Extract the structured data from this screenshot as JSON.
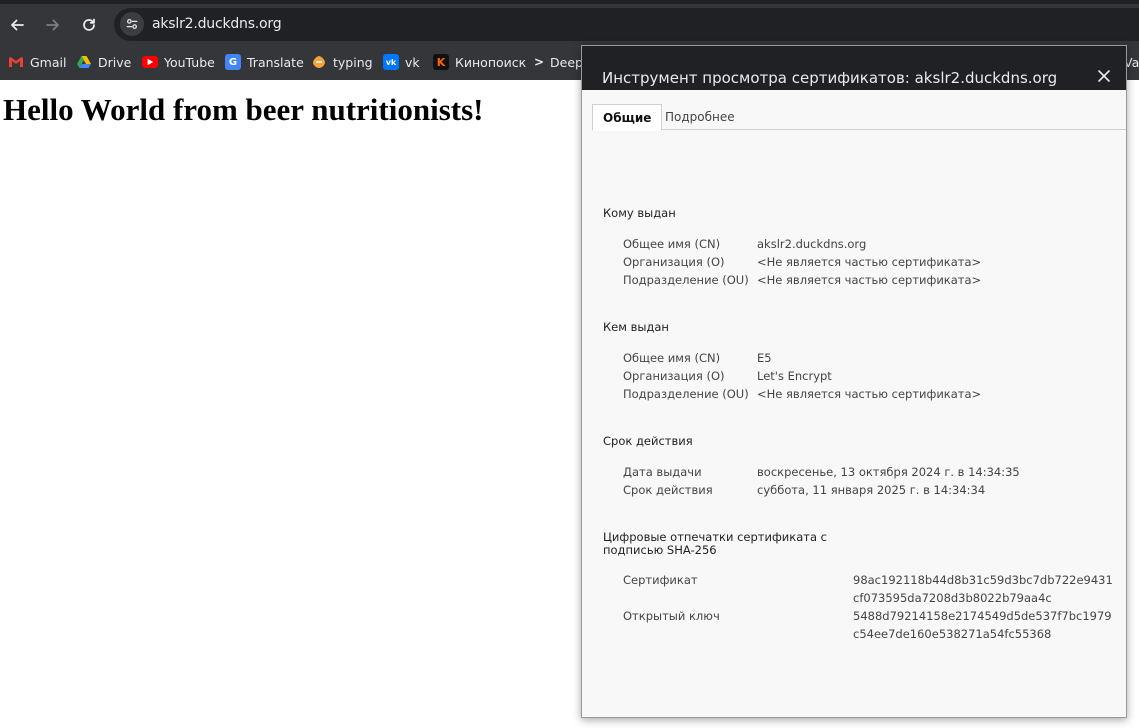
{
  "browser": {
    "url": "akslr2.duckdns.org",
    "bookmarks": [
      {
        "label": "Gmail",
        "icon": "gmail-icon"
      },
      {
        "label": "Drive",
        "icon": "drive-icon"
      },
      {
        "label": "YouTube",
        "icon": "youtube-icon"
      },
      {
        "label": "Translate",
        "icon": "translate-icon"
      },
      {
        "label": "typing",
        "icon": "typing-icon"
      },
      {
        "label": "vk",
        "icon": "vk-icon"
      },
      {
        "label": "Кинопоиск",
        "icon": "kinopoisk-icon"
      },
      {
        "label": "Deep",
        "icon": "deepl-icon"
      },
      {
        "label": "Var",
        "icon": ""
      }
    ]
  },
  "page": {
    "heading": "Hello World from beer nutritionists!"
  },
  "dialog": {
    "title": "Инструмент просмотра сертификатов: akslr2.duckdns.org",
    "tabs": [
      "Общие",
      "Подробнее"
    ],
    "issued_to": {
      "title": "Кому выдан",
      "rows": [
        {
          "label": "Общее имя (CN)",
          "value": "akslr2.duckdns.org"
        },
        {
          "label": "Организация (O)",
          "value": "<Не является частью сертификата>"
        },
        {
          "label": "Подразделение (OU)",
          "value": "<Не является частью сертификата>"
        }
      ]
    },
    "issued_by": {
      "title": "Кем выдан",
      "rows": [
        {
          "label": "Общее имя (CN)",
          "value": "E5"
        },
        {
          "label": "Организация (O)",
          "value": "Let's Encrypt"
        },
        {
          "label": "Подразделение (OU)",
          "value": "<Не является частью сертификата>"
        }
      ]
    },
    "validity": {
      "title": "Срок действия",
      "rows": [
        {
          "label": "Дата выдачи",
          "value": "воскресенье, 13 октября 2024 г. в 14:34:35"
        },
        {
          "label": "Срок действия",
          "value": "суббота, 11 января 2025 г. в 14:34:34"
        }
      ]
    },
    "fingerprints": {
      "title": "Цифровые отпечатки сертификата с подписью SHA-256",
      "rows": [
        {
          "label": "Сертификат",
          "value": "98ac192118b44d8b31c59d3bc7db722e9431cf073595da7208d3b8022b79aa4c"
        },
        {
          "label": "Открытый ключ",
          "value": "5488d79214158e2174549d5de537f7bc1979c54ee7de160e538271a54fc55368"
        }
      ]
    }
  }
}
